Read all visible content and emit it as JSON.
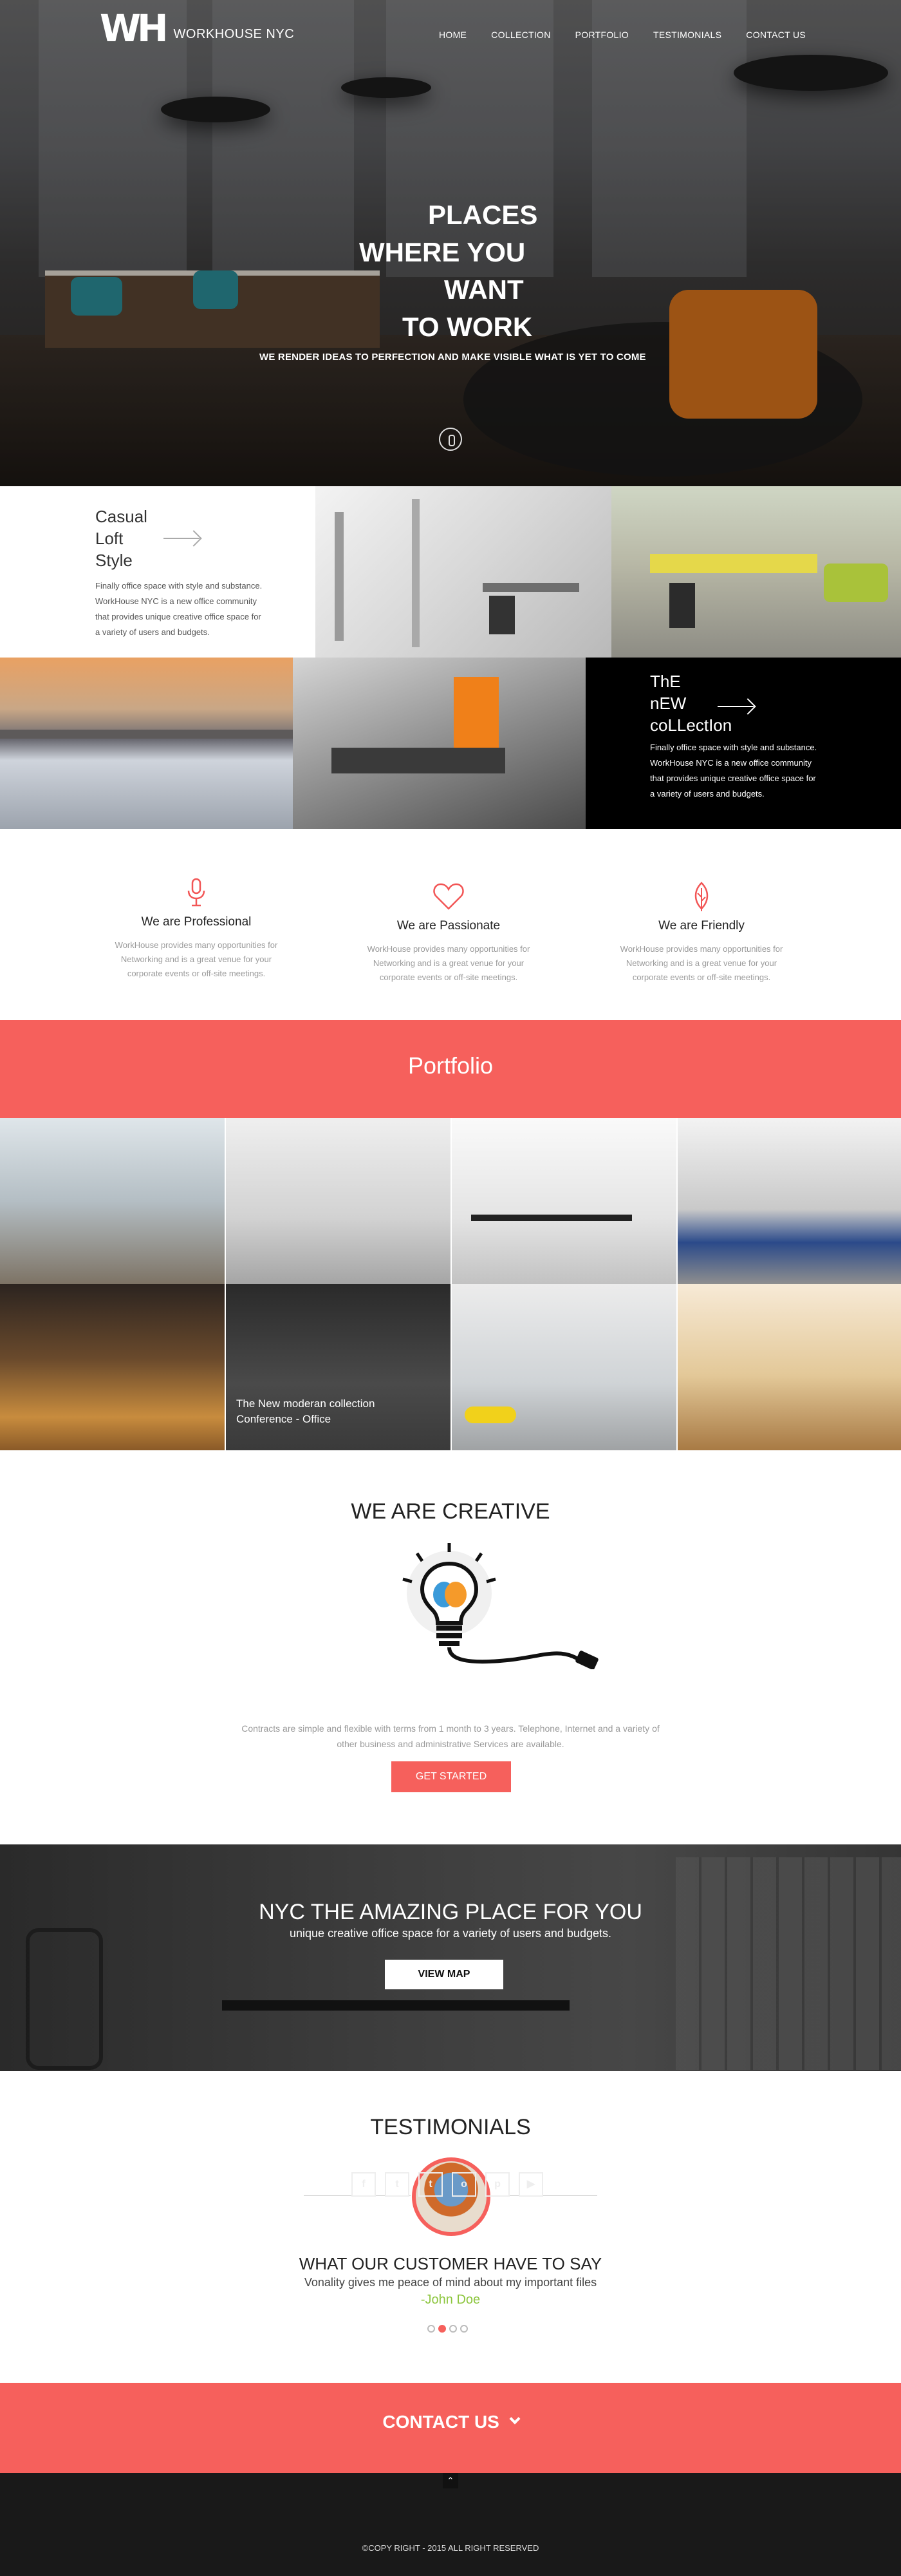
{
  "brand": {
    "mark": "WH",
    "name": "WORKHOUSE NYC"
  },
  "nav": [
    "HOME",
    "COLLECTION",
    "PORTFOLIO",
    "TESTIMONIALS",
    "CONTACT US"
  ],
  "hero": {
    "headline": [
      "PLACES",
      "WHERE YOU",
      "WANT",
      "TO WORK"
    ],
    "subline": "WE RENDER IDEAS TO PERFECTION AND MAKE VISIBLE WHAT IS YET TO COME",
    "scroll_icon": "mouse-scroll-icon"
  },
  "tiles": {
    "casual": {
      "title": [
        "Casual",
        "Loft",
        "Style"
      ],
      "text": [
        "Finally office space with style and substance.",
        "WorkHouse NYC is a new office community",
        "that provides unique creative office space for",
        "a variety of users and budgets."
      ]
    },
    "collection": {
      "title": [
        "ThE",
        "nEW",
        "coLLectIon"
      ],
      "text": [
        "Finally office space with style and substance.",
        "WorkHouse NYC is a new office community",
        "that provides unique creative office space for",
        "a variety of users and budgets."
      ]
    }
  },
  "features": [
    {
      "title": "We are Professional",
      "icon": "microphone-icon",
      "text": [
        "WorkHouse provides many opportunities for",
        "Networking and is a great venue for your",
        "corporate events or off-site meetings."
      ]
    },
    {
      "title": "We are Passionate",
      "icon": "heart-icon",
      "text": [
        "WorkHouse provides many opportunities for",
        "Networking and is a great venue for your",
        "corporate events or off-site meetings."
      ]
    },
    {
      "title": "We are Friendly",
      "icon": "leaf-icon",
      "text": [
        "WorkHouse provides many opportunities for",
        "Networking and is a great venue for your",
        "corporate events or off-site meetings."
      ]
    }
  ],
  "portfolio": {
    "title": "Portfolio",
    "caption": [
      "The New moderan collection",
      "Conference - Office"
    ]
  },
  "creative": {
    "title": "WE ARE CREATIVE",
    "text": [
      "Contracts are simple and flexible with terms from 1 month to 3 years. Telephone, Internet and a variety of",
      "other business and administrative Services are available."
    ],
    "button": "GET STARTED"
  },
  "nyc": {
    "title": "NYC THE AMAZING PLACE FOR YOU",
    "subtitle": "unique creative office space for a variety of users and budgets.",
    "button": "VIEW MAP"
  },
  "testimonials": {
    "title": "TESTIMONIALS",
    "heading": "WHAT OUR CUSTOMER HAVE TO SAY",
    "quote": "Vonality gives me peace of mind about my important files",
    "author": "-John Doe",
    "dots": 4,
    "active_dot": 2
  },
  "contact": {
    "label": "CONTACT US",
    "chevron": "chevron-down-icon",
    "top_icon": "arrow-up-icon"
  },
  "footer": {
    "social": [
      "f",
      "t",
      "t",
      "o",
      "p",
      "▶"
    ],
    "social_names": [
      "facebook-icon",
      "twitter-icon",
      "tumblr-icon",
      "instagram-icon",
      "pinterest-icon",
      "youtube-icon"
    ],
    "copyright": "©COPY RIGHT - 2015 ALL RIGHT RESERVED"
  },
  "colors": {
    "accent": "#f6605c",
    "dark": "#191919",
    "author": "#8dc63f"
  }
}
